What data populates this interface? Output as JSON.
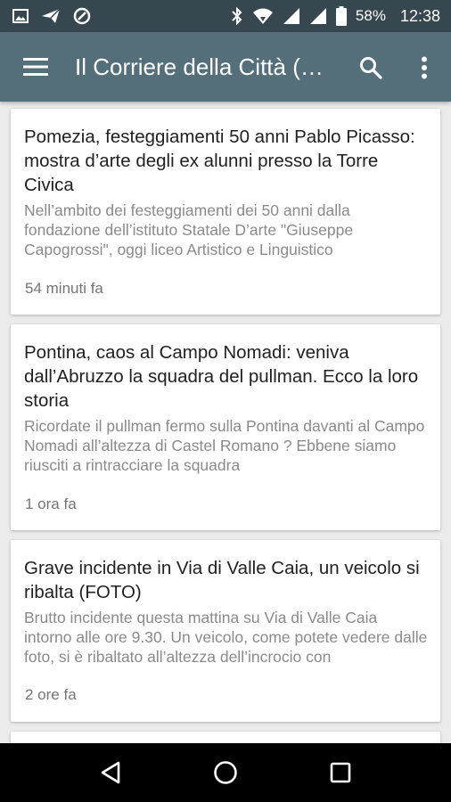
{
  "status_bar": {
    "icons_left": [
      "image-icon",
      "send-icon",
      "shield-icon"
    ],
    "icons_right": [
      "bluetooth-icon",
      "wifi-icon",
      "signal-icon",
      "signal-icon",
      "battery-icon"
    ],
    "battery": "58%",
    "time": "12:38"
  },
  "app_bar": {
    "title": "Il Corriere della Città (…",
    "menu_icon": "hamburger-menu-icon",
    "search_icon": "search-icon",
    "more_icon": "more-vert-icon"
  },
  "articles": [
    {
      "title": "Pomezia, festeggiamenti 50 anni Pablo Picasso: mostra d’arte degli ex alunni presso la Torre Civica",
      "summary": "Nell’ambito dei festeggiamenti dei 50 anni dalla fondazione dell’istituto Statale D’arte \"Giuseppe Capogrossi\", oggi liceo Artistico e Linguistico",
      "time": "54 minuti fa"
    },
    {
      "title": "Pontina, caos al Campo Nomadi: veniva dall’Abruzzo la squadra del pullman. Ecco la loro storia",
      "summary": "Ricordate il pullman fermo sulla Pontina davanti al Campo Nomadi all’altezza di Castel Romano ? Ebbene siamo riusciti a rintracciare la squadra",
      "time": "1 ora fa"
    },
    {
      "title": "Grave incidente in Via di Valle Caia, un veicolo si ribalta (FOTO)",
      "summary": "Brutto incidente questa mattina su Via di Valle Caia intorno alle ore 9.30. Un veicolo, come potete vedere dalle foto, si è ribaltato all’altezza dell’incrocio con",
      "time": "2 ore fa"
    }
  ],
  "nav_bar": {
    "buttons": [
      "back-icon",
      "home-icon",
      "recents-icon"
    ]
  },
  "colors": {
    "status_bar": "#37474f",
    "app_bar": "#546e7a",
    "background": "#ebebeb",
    "card": "#ffffff",
    "title_text": "#212121",
    "summary_text": "#8a8a8a"
  }
}
